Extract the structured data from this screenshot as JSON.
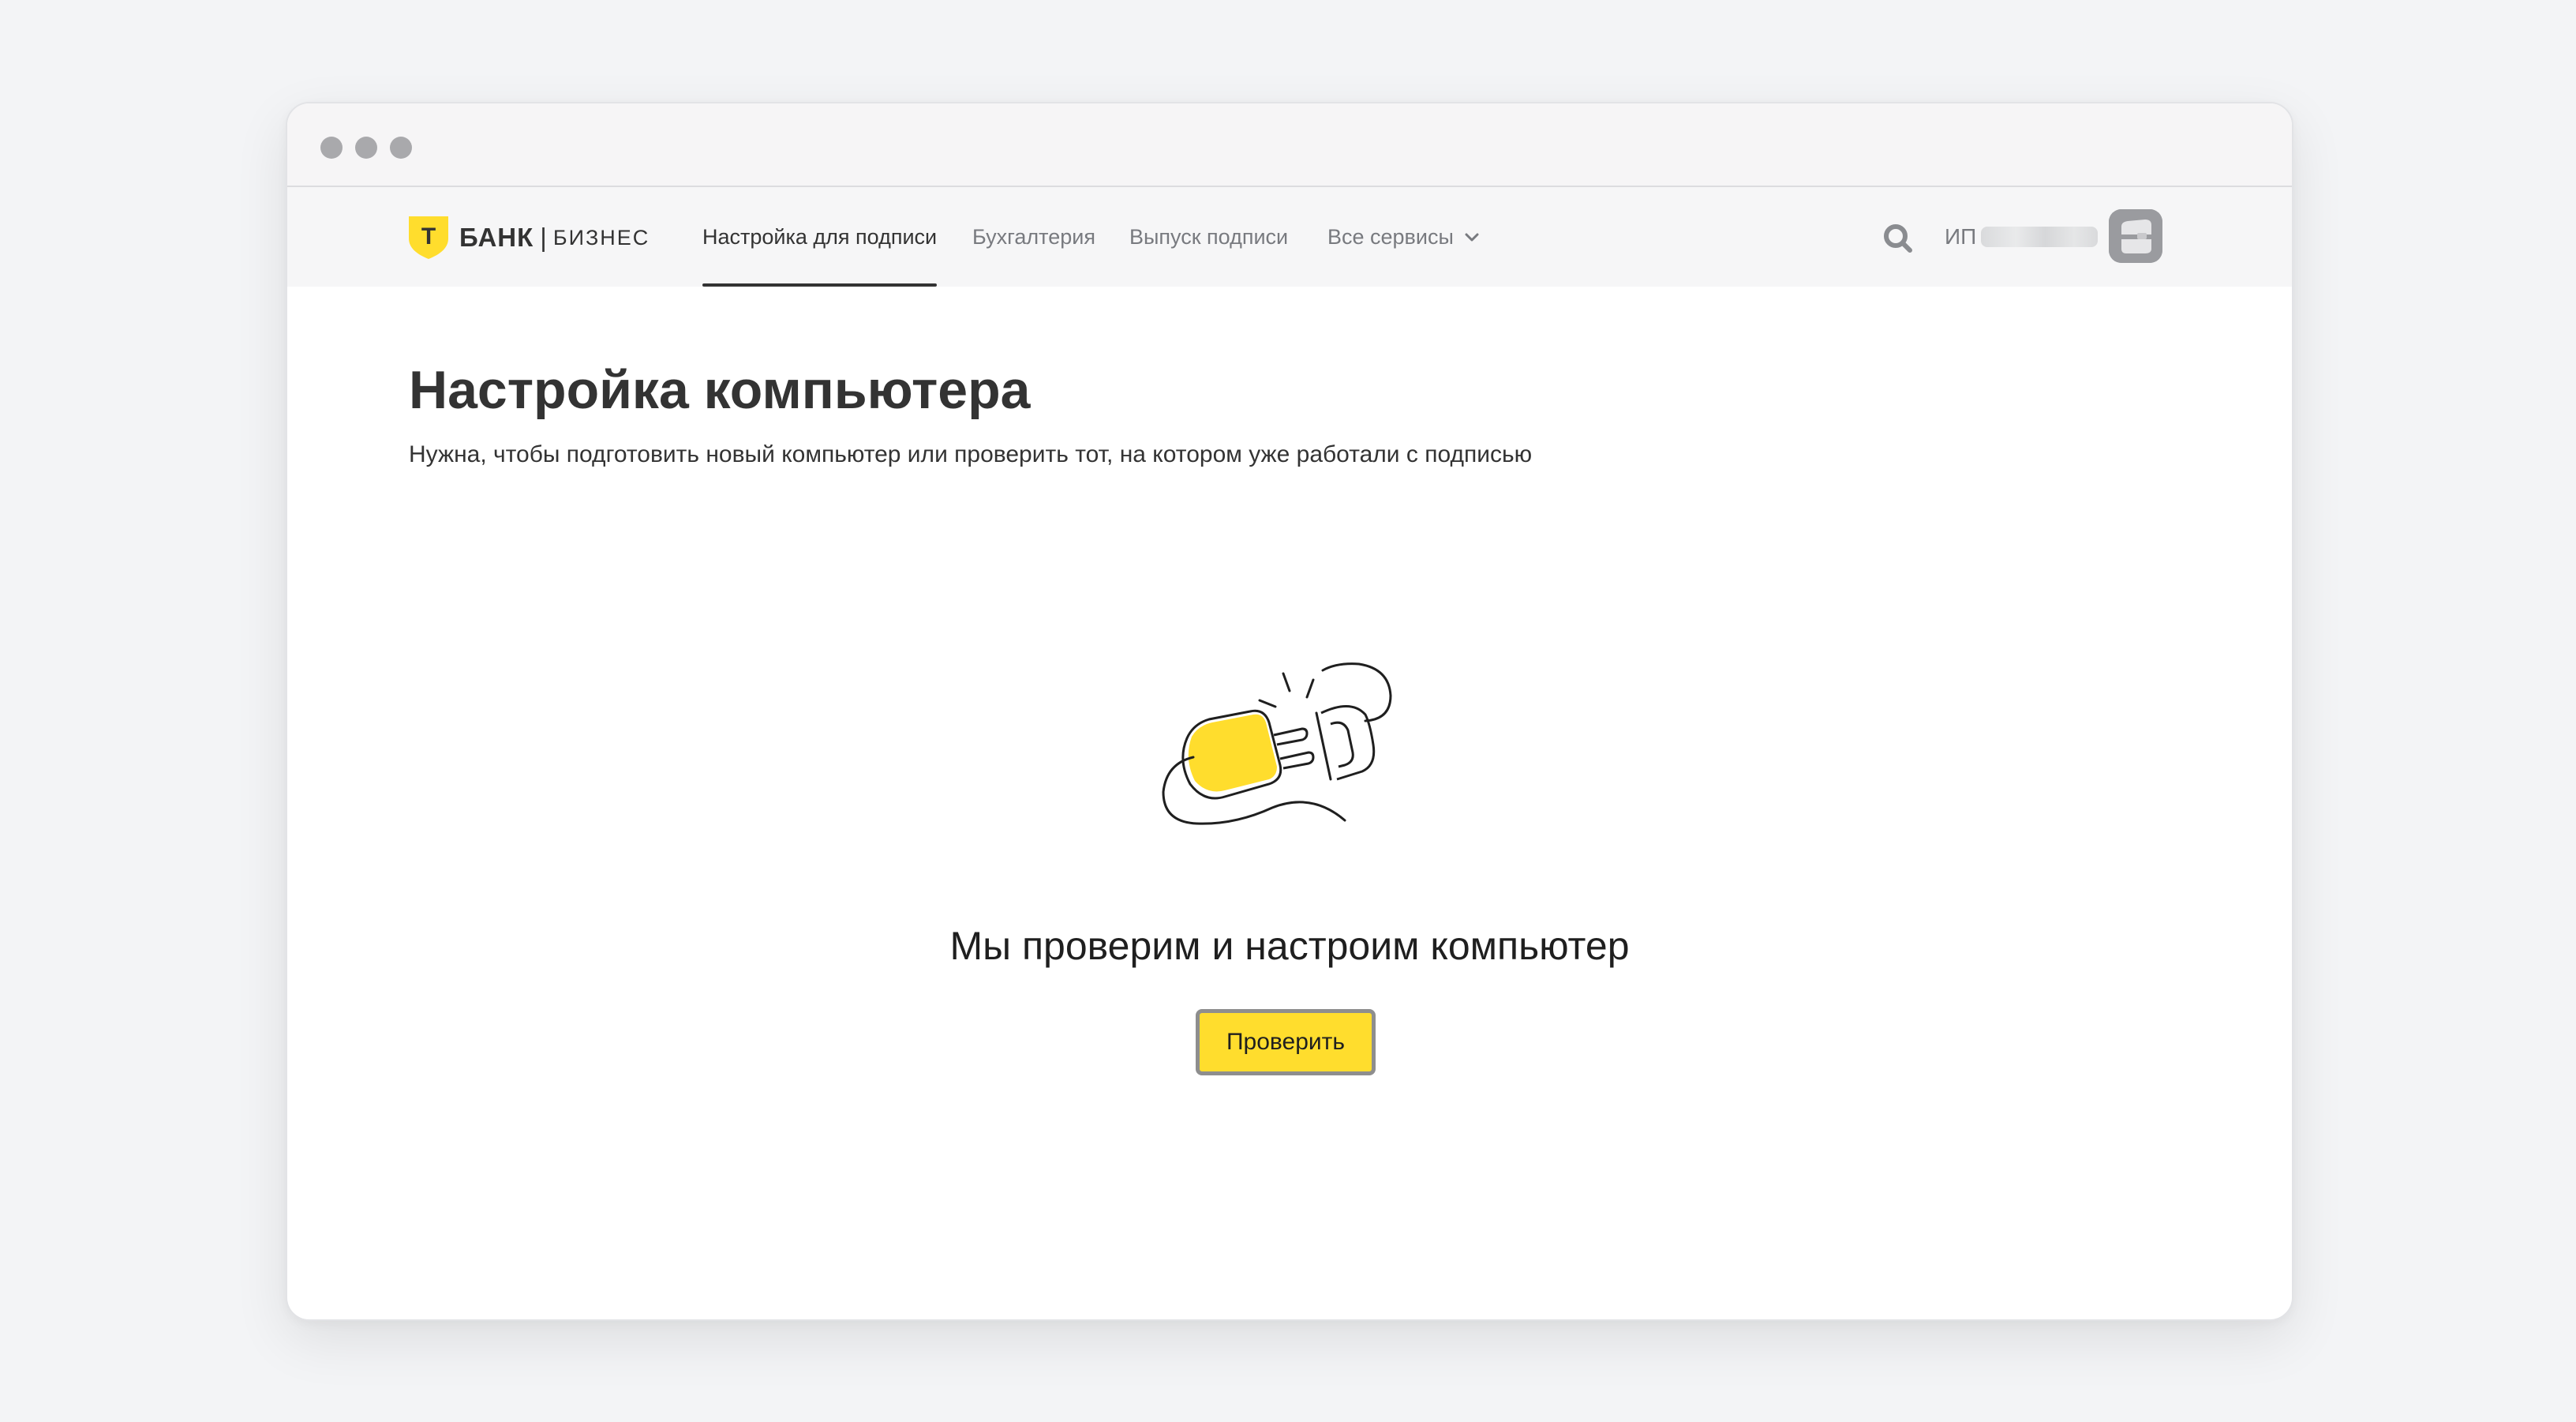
{
  "window": {
    "controls": [
      "window-dot",
      "window-dot",
      "window-dot"
    ]
  },
  "header": {
    "logo": {
      "bank": "БАНК",
      "separator": "|",
      "business": "БИЗНЕС",
      "shield_letter": "Т",
      "shield_color": "#ffdd2d"
    },
    "nav": [
      {
        "label": "Настройка для подписи",
        "active": true
      },
      {
        "label": "Бухгалтерия",
        "active": false
      },
      {
        "label": "Выпуск подписи",
        "active": false
      },
      {
        "label": "Все сервисы",
        "active": false,
        "icon": "chevron-down-icon"
      }
    ],
    "search_icon": "search-icon",
    "user_prefix": "ИП",
    "avatar_icon": "briefcase-icon"
  },
  "main": {
    "title": "Настройка компьютера",
    "subtitle": "Нужна, чтобы подготовить новый компьютер или проверить тот, на котором уже работали с подписью",
    "empty_state": {
      "illustration_icon": "plug-disconnected-icon",
      "title": "Мы проверим и настроим компьютер",
      "button_label": "Проверить"
    }
  },
  "colors": {
    "accent": "#ffdd2d",
    "text": "#333333",
    "muted": "#787a7f",
    "background": "#f3f4f6"
  }
}
